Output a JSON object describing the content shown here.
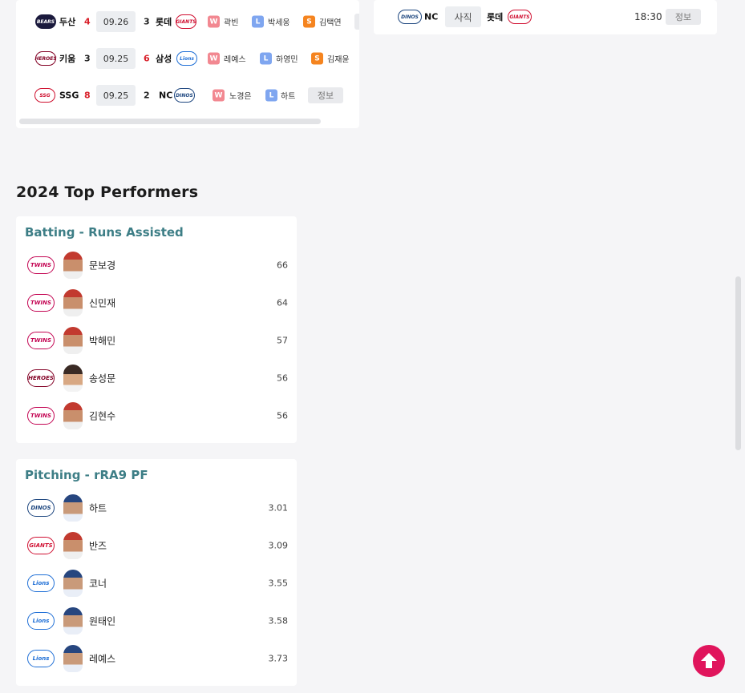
{
  "recent_games": [
    {
      "away": "두산",
      "away_score": "4",
      "date": "09.26",
      "home_score": "3",
      "home": "롯데",
      "pitchers": [
        {
          "r": "W",
          "name": "곽빈"
        },
        {
          "r": "L",
          "name": "박세웅"
        },
        {
          "r": "S",
          "name": "김택연"
        }
      ],
      "info": ""
    },
    {
      "away": "키움",
      "away_score": "3",
      "date": "09.25",
      "home_score": "6",
      "home": "삼성",
      "pitchers": [
        {
          "r": "W",
          "name": "레예스"
        },
        {
          "r": "L",
          "name": "하영민"
        },
        {
          "r": "S",
          "name": "김재윤"
        }
      ],
      "info": ""
    },
    {
      "away": "SSG",
      "away_score": "8",
      "date": "09.25",
      "home_score": "2",
      "home": "NC",
      "pitchers": [
        {
          "r": "W",
          "name": "노경은"
        },
        {
          "r": "L",
          "name": "하트"
        }
      ],
      "info": "정보"
    }
  ],
  "upcoming_game": {
    "away": "NC",
    "venue": "사직",
    "home": "롯데",
    "time": "18:30",
    "info": "정보"
  },
  "section_title": "2024 Top Performers",
  "batting": {
    "title": "Batting - Runs Assisted",
    "players": [
      {
        "name": "문보경",
        "value": "66"
      },
      {
        "name": "신민재",
        "value": "64"
      },
      {
        "name": "박해민",
        "value": "57"
      },
      {
        "name": "송성문",
        "value": "56"
      },
      {
        "name": "김현수",
        "value": "56"
      }
    ]
  },
  "pitching": {
    "title": "Pitching - rRA9 PF",
    "players": [
      {
        "name": "하트",
        "value": "3.01"
      },
      {
        "name": "반즈",
        "value": "3.09"
      },
      {
        "name": "코너",
        "value": "3.55"
      },
      {
        "name": "원태인",
        "value": "3.58"
      },
      {
        "name": "레예스",
        "value": "3.73"
      }
    ]
  },
  "icons": {
    "scroll_top": "arrow-up-icon"
  },
  "colors": {
    "accent": "#e0155c",
    "section_title": "#3d7e86",
    "win_score": "#d9202a"
  }
}
